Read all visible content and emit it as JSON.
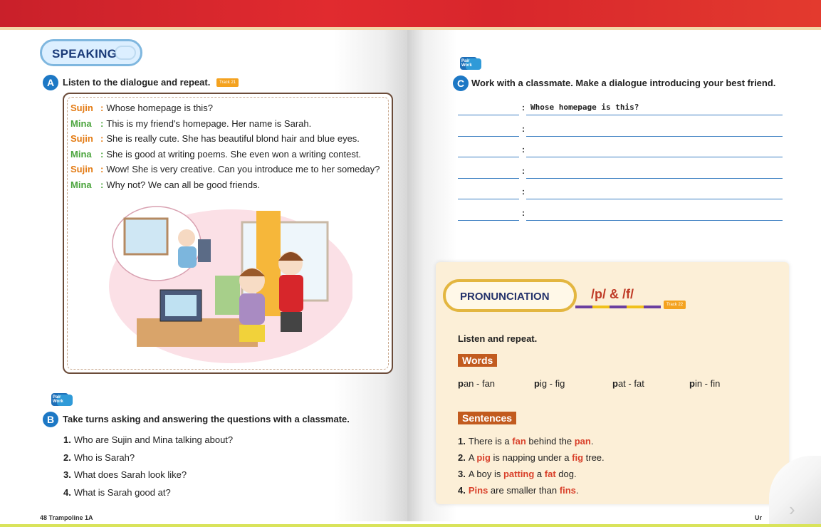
{
  "left_page": {
    "section_title": "SPEAKING",
    "a": {
      "letter": "A",
      "instruction": "Listen to the dialogue and repeat.",
      "track": "Track 21",
      "dialogue": [
        {
          "speaker": "Sujin",
          "line": "Whose homepage is this?"
        },
        {
          "speaker": "Mina",
          "line": "This is my friend's homepage. Her name is Sarah."
        },
        {
          "speaker": "Sujin",
          "line": "She is really cute. She has beautiful blond hair and blue eyes."
        },
        {
          "speaker": "Mina",
          "line": "She is good at writing poems. She even won a writing contest."
        },
        {
          "speaker": "Sujin",
          "line": "Wow! She is very creative. Can you introduce me to her someday?"
        },
        {
          "speaker": "Mina",
          "line": "Why not? We can all be good friends."
        }
      ]
    },
    "b": {
      "pair_label_1": "Pair",
      "pair_label_2": "Work",
      "letter": "B",
      "instruction": "Take turns asking and answering the questions with a classmate.",
      "questions": [
        {
          "num": "1.",
          "text": "Who are Sujin and Mina talking about?"
        },
        {
          "num": "2.",
          "text": "Who is Sarah?"
        },
        {
          "num": "3.",
          "text": "What does Sarah look like?"
        },
        {
          "num": "4.",
          "text": "What is Sarah good at?"
        }
      ]
    },
    "footer": "48 Trampoline 1A"
  },
  "right_page": {
    "c": {
      "pair_label_1": "Pair",
      "pair_label_2": "Work",
      "letter": "C",
      "instruction": "Work with a classmate. Make a dialogue introducing your best friend.",
      "first_line": "Whose homepage is this?",
      "colon": ":"
    },
    "pronunciation": {
      "title": "PRONUNCIATION",
      "sounds": "/p/ & /f/",
      "track": "Track 22",
      "instruction": "Listen and repeat.",
      "words_label": "Words",
      "words": [
        {
          "bold": "p",
          "rest": "an - fan"
        },
        {
          "bold": "p",
          "rest": "ig - fig"
        },
        {
          "bold": "p",
          "rest": "at - fat"
        },
        {
          "bold": "p",
          "rest": "in - fin"
        }
      ],
      "sentences_label": "Sentences",
      "sentences": [
        {
          "num": "1.",
          "parts": [
            [
              "There is a ",
              false
            ],
            [
              "fan",
              true
            ],
            [
              " behind the ",
              false
            ],
            [
              "pan",
              true
            ],
            [
              ".",
              false
            ]
          ]
        },
        {
          "num": "2.",
          "parts": [
            [
              "A ",
              false
            ],
            [
              "pig",
              true
            ],
            [
              " is napping under a ",
              false
            ],
            [
              "fig",
              true
            ],
            [
              " tree.",
              false
            ]
          ]
        },
        {
          "num": "3.",
          "parts": [
            [
              "A boy is ",
              false
            ],
            [
              "patting",
              true
            ],
            [
              " a ",
              false
            ],
            [
              "fat",
              true
            ],
            [
              " dog.",
              false
            ]
          ]
        },
        {
          "num": "4.",
          "parts": [
            [
              "Pins",
              true
            ],
            [
              " are smaller than ",
              false
            ],
            [
              "fins",
              true
            ],
            [
              ".",
              false
            ]
          ]
        }
      ]
    },
    "footer": "Ur"
  }
}
